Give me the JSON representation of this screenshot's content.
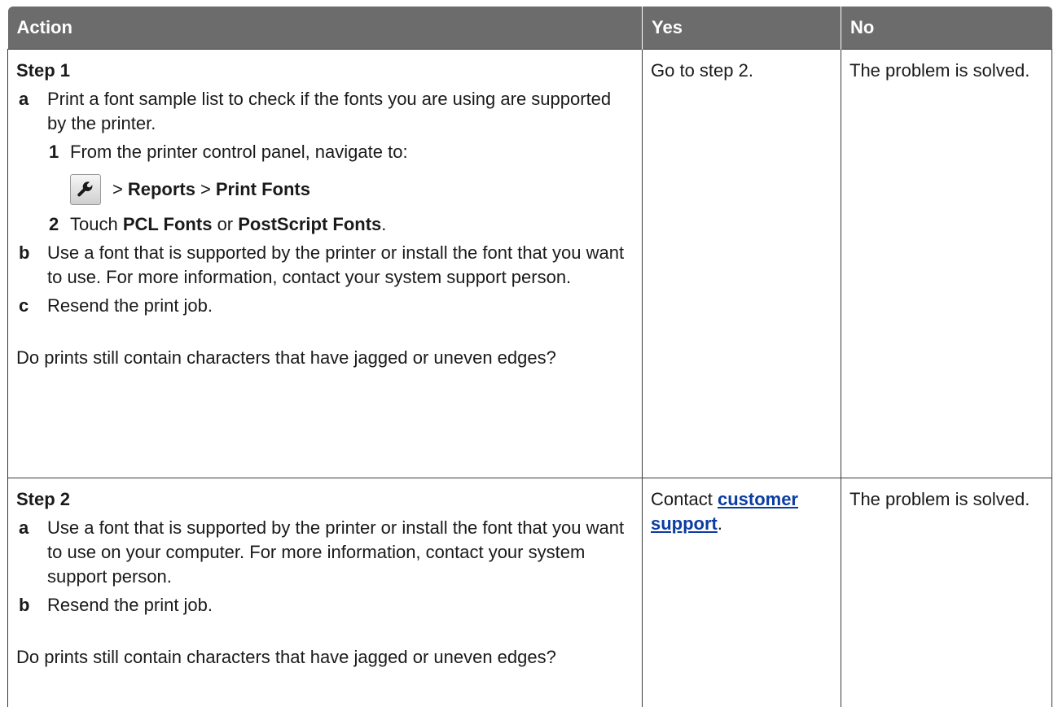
{
  "header": {
    "action": "Action",
    "yes": "Yes",
    "no": "No"
  },
  "step1": {
    "title": "Step 1",
    "a_letter": "a",
    "a_text": "Print a font sample list to check if the fonts you are using are supported by the printer.",
    "n1_marker": "1",
    "n1_text": "From the printer control panel, navigate to:",
    "nav_icon": "wrench-icon",
    "nav_sep1": ">",
    "nav_reports": "Reports",
    "nav_sep2": ">",
    "nav_print_fonts": "Print Fonts",
    "n2_marker": "2",
    "n2_prefix": "Touch",
    "n2_pcl": "PCL Fonts",
    "n2_or": "or",
    "n2_ps": "PostScript Fonts",
    "n2_suffix": ".",
    "b_letter": "b",
    "b_text": "Use a font that is supported by the printer or install the font that you want to use. For more information, contact your system support person.",
    "c_letter": "c",
    "c_text": "Resend the print job.",
    "question": "Do prints still contain characters that have jagged or uneven edges?",
    "yes": "Go to step 2.",
    "no": "The problem is solved."
  },
  "step2": {
    "title": "Step 2",
    "a_letter": "a",
    "a_text": "Use a font that is supported by the printer or install the font that you want to use on your computer. For more information, contact your system support person.",
    "b_letter": "b",
    "b_text": "Resend the print job.",
    "question": "Do prints still contain characters that have jagged or uneven edges?",
    "yes_prefix": "Contact",
    "yes_link": "customer support",
    "yes_suffix": ".",
    "no": "The problem is solved."
  },
  "colors": {
    "header_bg": "#6c6c6c",
    "link": "#0b3da0",
    "border": "#3a3a3a"
  }
}
